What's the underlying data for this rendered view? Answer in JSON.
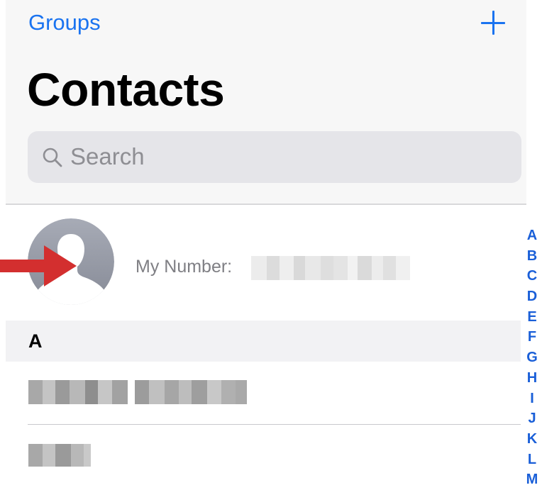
{
  "header": {
    "groups_label": "Groups",
    "add_icon": "plus-icon",
    "title": "Contacts"
  },
  "search": {
    "placeholder": "Search",
    "icon": "magnifier-icon"
  },
  "my_card": {
    "label": "My Number:",
    "avatar_icon": "person-silhouette-icon",
    "value_redacted": true
  },
  "sections": [
    {
      "letter": "A",
      "contacts_redacted_count": 2
    }
  ],
  "index_letters": [
    "A",
    "B",
    "C",
    "D",
    "E",
    "F",
    "G",
    "H",
    "I",
    "J",
    "K",
    "L",
    "M"
  ],
  "colors": {
    "accent": "#1a73f0",
    "index": "#1a5fd8",
    "annotation_arrow": "#d32f2f",
    "header_bg": "#f7f7f7",
    "search_bg": "#e5e5e9"
  }
}
